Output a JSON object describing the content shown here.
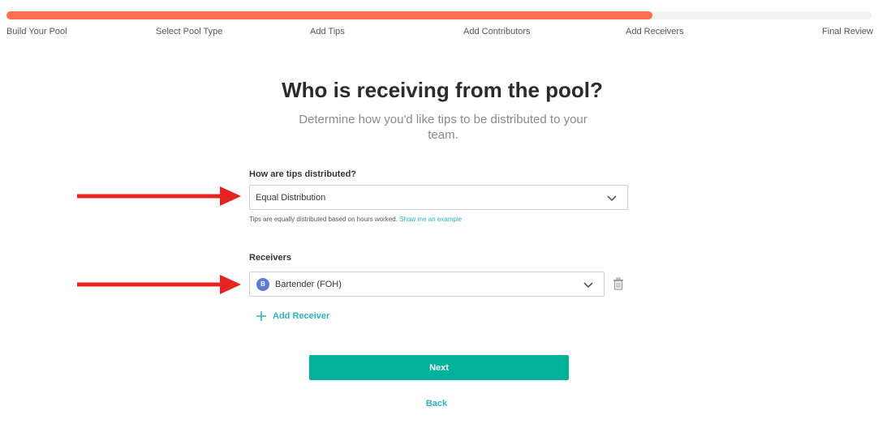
{
  "progress": {
    "fraction": 0.747,
    "color": "#ff6e4f"
  },
  "steps": [
    "Build Your Pool",
    "Select Pool Type",
    "Add Tips",
    "Add Contributors",
    "Add Receivers",
    "Final Review"
  ],
  "page": {
    "title": "Who is receiving from the pool?",
    "subtitle": "Determine how you'd like tips to be distributed to your team."
  },
  "distribution": {
    "label": "How are tips distributed?",
    "selected": "Equal Distribution",
    "hint": "Tips are equally distributed based on hours worked.",
    "hint_link": "Show me an example"
  },
  "receivers": {
    "label": "Receivers",
    "items": [
      {
        "initial": "B",
        "name": "Bartender (FOH)",
        "icon": "trash-icon"
      }
    ],
    "add_label": "Add Receiver"
  },
  "actions": {
    "next": "Next",
    "back": "Back"
  },
  "annotations": {
    "arrow_color": "#e8231f"
  },
  "colors": {
    "accent": "#2ab0c7",
    "primary_button": "#00b29b",
    "avatar": "#5b7bd5"
  }
}
